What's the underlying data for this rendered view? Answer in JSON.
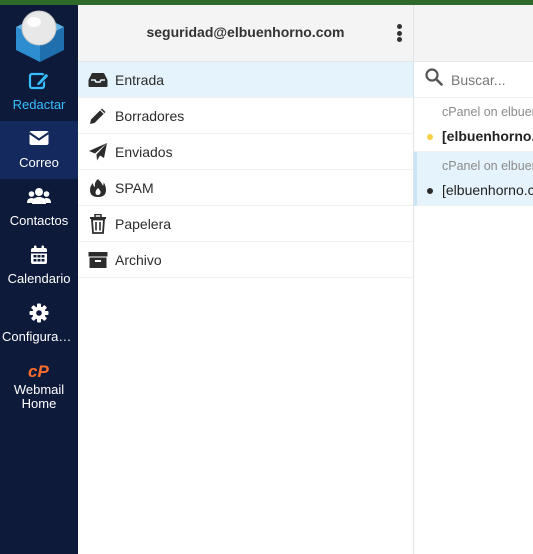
{
  "colors": {
    "sidebar": "#0d1a3a",
    "sidebar_active": "#142a5e",
    "accent": "#37beff",
    "cpanel_orange": "#ff6c2c",
    "selected_row": "#e5f4fc",
    "unread_dot": "#f7d046"
  },
  "sidebar": {
    "items": [
      {
        "label": "Redactar",
        "icon": "compose-icon"
      },
      {
        "label": "Correo",
        "icon": "envelope-icon"
      },
      {
        "label": "Contactos",
        "icon": "users-icon"
      },
      {
        "label": "Calendario",
        "icon": "calendar-icon"
      },
      {
        "label": "Configuraci…",
        "icon": "gear-icon"
      },
      {
        "label": "Webmail Home",
        "icon": "cpanel-icon"
      }
    ]
  },
  "account": {
    "email": "seguridad@elbuenhorno.com"
  },
  "folders": [
    {
      "label": "Entrada",
      "icon": "inbox-icon"
    },
    {
      "label": "Borradores",
      "icon": "pencil-icon"
    },
    {
      "label": "Enviados",
      "icon": "paper-plane-icon"
    },
    {
      "label": "SPAM",
      "icon": "fire-icon"
    },
    {
      "label": "Papelera",
      "icon": "trash-icon"
    },
    {
      "label": "Archivo",
      "icon": "archive-icon"
    }
  ],
  "search": {
    "placeholder": "Buscar..."
  },
  "messages": [
    {
      "from": "cPanel on elbuenhorno.com",
      "subject": "[elbuenhorno.com]",
      "unread": true
    },
    {
      "from": "cPanel on elbuenhorno.com",
      "subject": "[elbuenhorno.com]",
      "unread": false
    }
  ]
}
